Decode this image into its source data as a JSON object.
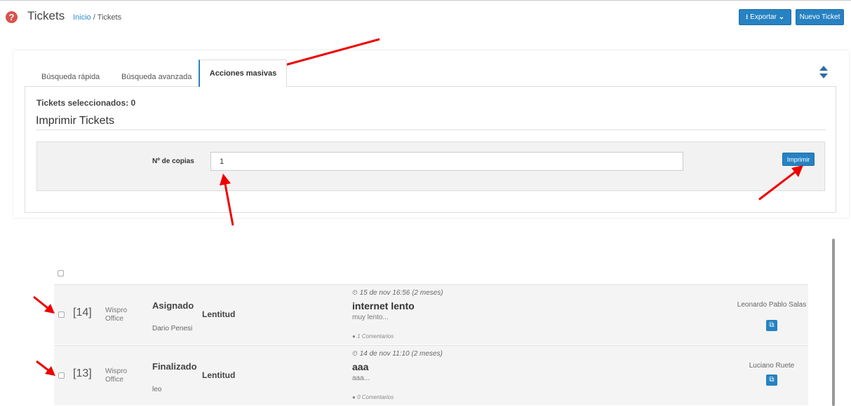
{
  "header": {
    "title": "Tickets",
    "breadcrumb_home": "Inicio",
    "breadcrumb_sep": " / ",
    "breadcrumb_current": "Tickets",
    "export_label": "Exportar",
    "new_ticket_label": "Nuevo Ticket"
  },
  "tabs": {
    "quick": "Búsqueda rápida",
    "advanced": "Búsqueda avanzada",
    "bulk": "Acciones masivas"
  },
  "bulk": {
    "selected_label": "Tickets seleccionados: 0",
    "section_title": "Imprimir Tickets",
    "copies_label": "Nº de copias",
    "copies_value": "1",
    "print_button": "Imprimir"
  },
  "tickets": [
    {
      "id": "[14]",
      "office_line1": "Wispro",
      "office_line2": "Office",
      "status": "Asignado",
      "user": "Dario Penesi",
      "category": "Lentitud",
      "date": "15 de nov 16:56 (2 meses)",
      "subject": "internet lento",
      "description": "muy lento...",
      "comments": "1 Comentarios",
      "assignee": "Leonardo Pablo Salas"
    },
    {
      "id": "[13]",
      "office_line1": "Wispro",
      "office_line2": "Office",
      "status": "Finalizado",
      "user": "leo",
      "category": "Lentitud",
      "date": "14 de nov 11:10 (2 meses)",
      "subject": "aaa",
      "description": "aaa...",
      "comments": "0 Comentarios",
      "assignee": "Luciano Ruete"
    }
  ],
  "colors": {
    "primary": "#2682c2",
    "danger": "#d9534f",
    "annotation": "#ee0000"
  },
  "icons": {
    "help": "question-circle",
    "export": "download",
    "sort": "sort-up-down",
    "clock": "clock",
    "comment": "comment-bubble",
    "copy": "copy"
  }
}
